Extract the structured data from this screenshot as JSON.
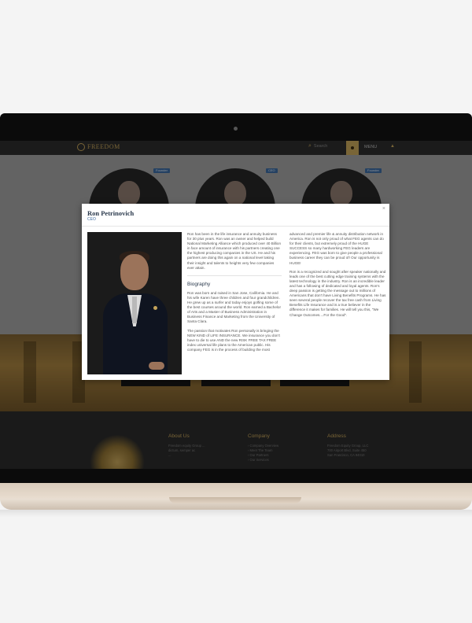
{
  "site": {
    "logo_text": "FREEDOM",
    "search_placeholder": "Search",
    "menu_label": "MENU",
    "up_arrow": "▲"
  },
  "team": {
    "badges": [
      "Founder",
      "CEO",
      "Founder"
    ]
  },
  "footer": {
    "about_heading": "About Us",
    "about_lines": [
      "Freedom equity Group ...",
      "dictum, semper ac",
      "..."
    ],
    "company_heading": "Company",
    "company_lines": [
      "› Company Overview",
      "› Meet The Team",
      "› Our Partners",
      "› Our Services"
    ],
    "address_heading": "Address",
    "address_lines": [
      "Freedom Equity Group, LLC",
      "700 Airport Blvd, Suite 450",
      "San Francisco, CA 94010"
    ]
  },
  "modal": {
    "name": "Ron Petrinovich",
    "role": "CEO",
    "close_glyph": "×",
    "intro": "Ron has been in the life insurance and annuity business for 30 plus years. Ron was an owner and helped build National Marketing Alliance which produced over 40 Billion in face amount of insurance with his partners creating one the highest producing companies in the US. He and his partners are doing this again on a national level taking their insight and talents to heights very few companies ever attain.",
    "bio_heading": "Biography",
    "bio_p1": "Ron was born and raised in San Jose, California. He and his wife Karen have three children and four grandchildren. He grew up as a surfer and today enjoys golfing some of the best courses around the world. Ron earned a Bachelor of Arts and a Master of Business Administration in Business Finance and Marketing from the University of Santa Clara.",
    "bio_p2": "The passion that motivates Ron personally is bringing the NEW KIND of LIFE INSURANCE. We insurance you don't have to die to use AND the new RISK FREE TAX FREE index universal life plans to the American public. His company FEG is in the process of building the most",
    "col2_p1": "advanced and premier life & annuity distribution network in America. Ron is not only proud of what FEG agents can do for their clients, but extremely proud of the HUGE SUCCESS so many hardworking FEG leaders are experiencing. FEG was born to give people a professional business career they can be proud of! Our opportunity is HUGE!",
    "col2_p2": "Ron is a recognized and sought after speaker nationally and leads one of the best cutting edge training systems with the latest technology in the industry. Ron is an incredible leader and has a following of dedicated and loyal agents. Ron's deep passion is getting the message out to millions of Americans that don't have Living Benefits Programs. He has seen several people recover the tax free cash from Living Benefits Life Insurance and is a true believer in the difference it makes for families. He will tell you this, \"We Change Outcomes....For the Good\"."
  }
}
